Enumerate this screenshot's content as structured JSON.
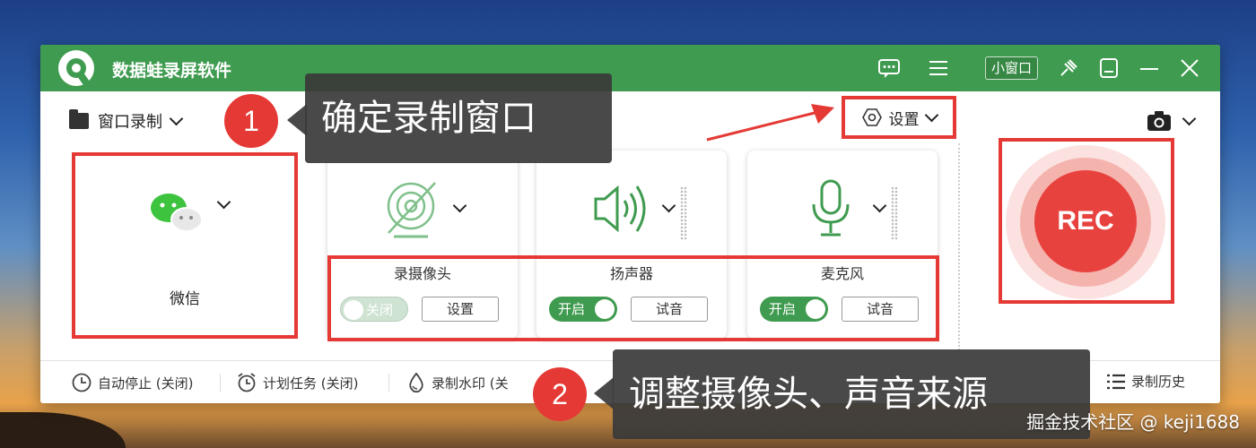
{
  "app": {
    "title": "数据蛙录屏软件",
    "icons": [
      "chat-icon",
      "menu-icon",
      "pin-icon",
      "skin-icon",
      "minimize-icon",
      "close-icon"
    ],
    "mini_window_label": "小窗口"
  },
  "toolbar": {
    "mode_label": "窗口录制",
    "settings_label": "设置"
  },
  "source": {
    "name": "微信",
    "icon": "wechat-icon"
  },
  "devices": [
    {
      "name": "录摄像头",
      "toggle_label": "关闭",
      "toggle_on": false,
      "button_label": "设置",
      "icon": "webcam-off-icon"
    },
    {
      "name": "扬声器",
      "toggle_label": "开启",
      "toggle_on": true,
      "button_label": "试音",
      "icon": "speaker-icon"
    },
    {
      "name": "麦克风",
      "toggle_label": "开启",
      "toggle_on": true,
      "button_label": "试音",
      "icon": "microphone-icon"
    }
  ],
  "rec": {
    "label": "REC"
  },
  "bottom_bar": {
    "auto_stop": "自动停止 (关闭)",
    "schedule": "计划任务 (关闭)",
    "watermark": "录制水印 (关",
    "history": "录制历史"
  },
  "callouts": [
    {
      "number": "1",
      "text": "确定录制窗口"
    },
    {
      "number": "2",
      "text": "调整摄像头、声音来源"
    }
  ],
  "image_watermark": "掘金技术社区 @ keji1688",
  "colors": {
    "brand_green": "#3f9b4f",
    "highlight_red": "#e53935",
    "rec_red": "#e8423f"
  }
}
